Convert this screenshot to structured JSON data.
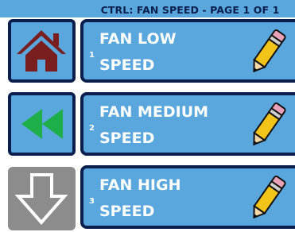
{
  "header": {
    "title": "CTRL: FAN SPEED - PAGE 1 OF 1"
  },
  "sidebar": {
    "buttons": [
      {
        "name": "home",
        "icon": "home-icon",
        "enabled": true
      },
      {
        "name": "back",
        "icon": "rewind-icon",
        "enabled": true
      },
      {
        "name": "next-page",
        "icon": "down-arrow-icon",
        "enabled": false
      }
    ]
  },
  "items": [
    {
      "number": "1",
      "label": "FAN LOW\nSPEED",
      "edit_icon": "pencil-icon"
    },
    {
      "number": "2",
      "label": "FAN MEDIUM\nSPEED",
      "edit_icon": "pencil-icon"
    },
    {
      "number": "3",
      "label": "FAN HIGH\nSPEED",
      "edit_icon": "pencil-icon"
    }
  ],
  "colors": {
    "accent": "#5aa7de",
    "border": "#0a1f4d",
    "home_icon": "#7a1f1f",
    "back_icon": "#1faf4a",
    "disabled": "#8c8c8c",
    "pencil_body": "#f2c318"
  }
}
